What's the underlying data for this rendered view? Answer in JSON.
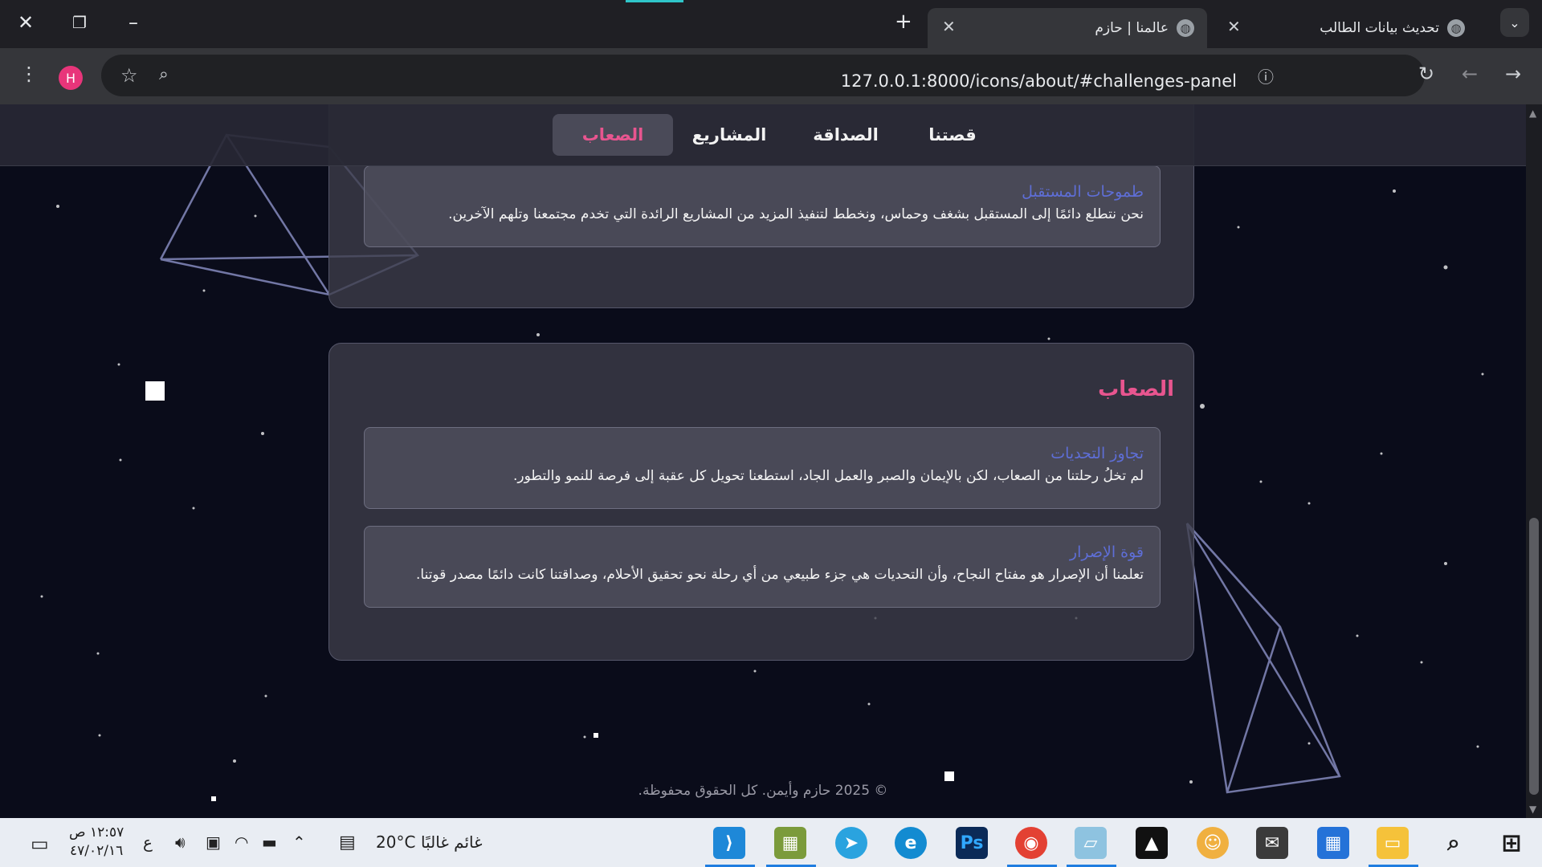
{
  "browser": {
    "tabs": [
      {
        "title": "تحديث بيانات الطالب",
        "active": false
      },
      {
        "title": "عالمنا | حازم",
        "active": true
      }
    ],
    "url": "127.0.0.1:8000/icons/about/#challenges-panel",
    "profile_initial": "H"
  },
  "nav": {
    "items": [
      {
        "label": "قصتنا"
      },
      {
        "label": "الصداقة"
      },
      {
        "label": "المشاريع"
      },
      {
        "label": "الصعاب"
      }
    ],
    "active_label": "الصعاب",
    "active_color": "#e8558f"
  },
  "future_card": {
    "title": "طموحات المستقبل",
    "text": "نحن نتطلع دائمًا إلى المستقبل بشغف وحماس، ونخطط لتنفيذ المزيد من المشاريع الرائدة التي تخدم مجتمعنا وتلهم الآخرين."
  },
  "challenges": {
    "title": "الصعاب",
    "cards": [
      {
        "title": "تجاوز التحديات",
        "text": "لم تخلُ رحلتنا من الصعاب، لكن بالإيمان والصبر والعمل الجاد، استطعنا تحويل كل عقبة إلى فرصة للنمو والتطور."
      },
      {
        "title": "قوة الإصرار",
        "text": "تعلمنا أن الإصرار هو مفتاح النجاح، وأن التحديات هي جزء طبيعي من أي رحلة نحو تحقيق الأحلام، وصداقتنا كانت دائمًا مصدر قوتنا."
      }
    ]
  },
  "footer": {
    "text": "© 2025 حازم وأيمن. كل الحقوق محفوظة."
  },
  "taskbar": {
    "weather_text": "غائم غالبًا",
    "temperature": "20°C",
    "time": "١٢:٥٧ ص",
    "date": "٤٧/٠٢/١٦",
    "lang": "ع",
    "apps": [
      "vscode-icon",
      "app-icon",
      "telegram-icon",
      "edge-icon",
      "photoshop-icon",
      "chrome-icon",
      "files-icon",
      "photos-icon",
      "avatar-app-icon",
      "mail-icon",
      "store-icon",
      "explorer-icon"
    ]
  }
}
